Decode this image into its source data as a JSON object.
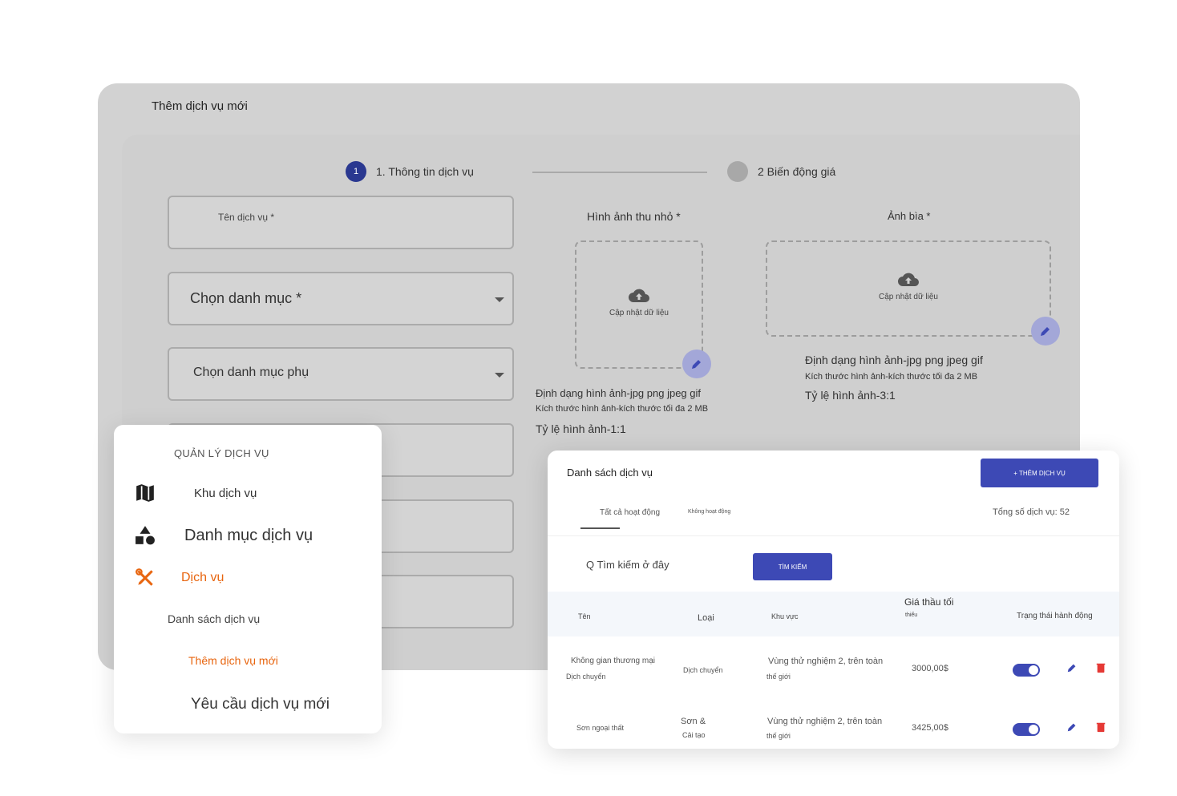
{
  "back_panel": {
    "title": "Thêm dịch vụ mới",
    "steps": [
      {
        "number": "1",
        "label": "1. Thông tin dịch vụ"
      },
      {
        "label": "2 Biến động giá"
      }
    ],
    "fields": {
      "service_name": "Tên dịch vụ *",
      "category": "Chọn danh mục *",
      "subcategory": "Chọn danh mục phụ"
    },
    "thumbnail": {
      "label": "Hình ảnh thu nhỏ *",
      "upload_text": "Cập nhật dữ liệu",
      "format": "Định dạng hình ảnh-jpg png jpeg gif",
      "size": "Kích thước hình ảnh-kích thước tối đa 2 MB",
      "ratio": "Tỷ lệ hình ảnh-1:1"
    },
    "cover": {
      "label": "Ảnh bìa *",
      "upload_text": "Cập nhật dữ liệu",
      "format": "Định dạng hình ảnh-jpg png jpeg gif",
      "size": "Kích thước hình ảnh-kích thước tối đa 2 MB",
      "ratio": "Tỷ lệ hình ảnh-3:1"
    }
  },
  "menu": {
    "heading": "QUẢN LÝ DỊCH VỤ",
    "items": [
      {
        "label": "Khu dịch vụ",
        "icon": "map-icon"
      },
      {
        "label": "Danh mục dịch vụ",
        "icon": "shapes-icon"
      },
      {
        "label": "Dịch vụ",
        "icon": "tools-icon",
        "active": true
      },
      {
        "label": "Danh sách dịch vụ"
      },
      {
        "label": "Thêm dịch vụ mới",
        "active": true
      },
      {
        "label": "Yêu cầu dịch vụ mới"
      }
    ],
    "accent_color": "#e8650f"
  },
  "table_card": {
    "title": "Danh sách dịch vụ",
    "add_button": "+ THÊM DỊCH VỤ",
    "tabs": [
      "Tất cả hoạt động",
      "Không hoạt động"
    ],
    "total": "Tổng số dịch vụ: 52",
    "search_placeholder": "Q Tìm kiếm ở đây",
    "search_button": "TÌM KIẾM",
    "columns": {
      "name": "Tên",
      "type": "Loại",
      "area": "Khu vực",
      "min_bid_line1": "Giá thầu tối",
      "min_bid_line2": "thiểu",
      "status": "Trạng thái hành động"
    },
    "rows": [
      {
        "name_line1": "Không gian thương mại",
        "name_line2": "Dịch chuyển",
        "type_line1": "Dịch chuyển",
        "type_line2": "",
        "area_line1": "Vùng thử nghiệm 2, trên toàn",
        "area_line2": "thế giới",
        "price": "3000,00$",
        "active": true
      },
      {
        "name_line1": "Sơn ngoại thất",
        "name_line2": "",
        "type_line1": "Sơn &",
        "type_line2": "Cải tạo",
        "area_line1": "Vùng thử nghiệm 2, trên toàn",
        "area_line2": "thế giới",
        "price": "3425,00$",
        "active": true
      }
    ],
    "accent_color": "#3d49b5",
    "delete_color": "#e53935"
  }
}
